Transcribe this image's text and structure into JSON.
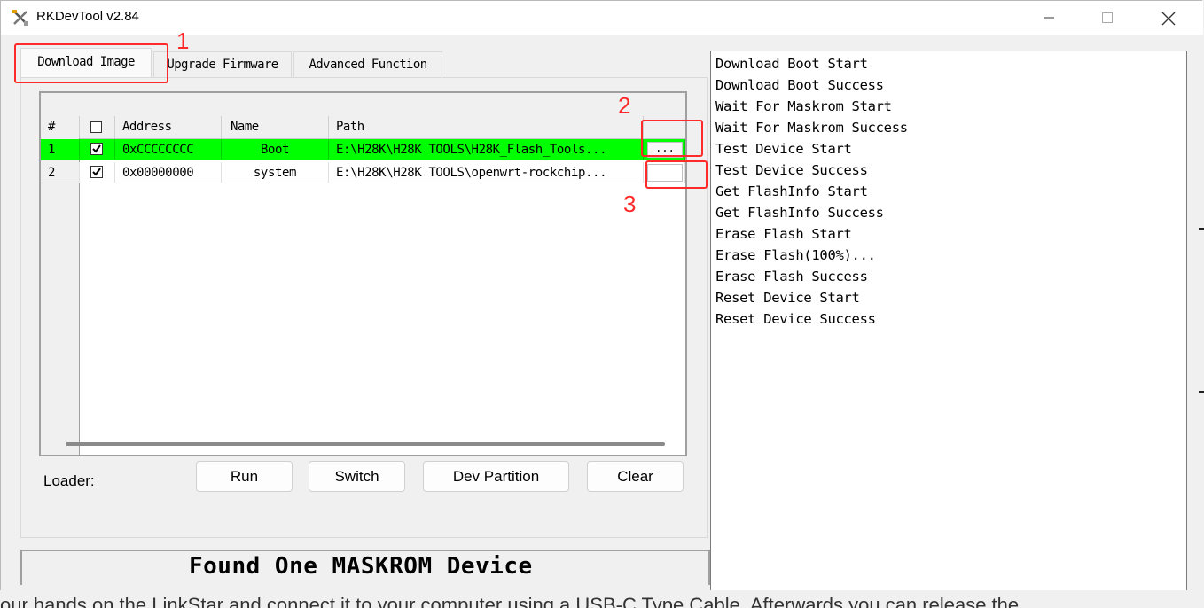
{
  "window": {
    "title": "RKDevTool v2.84"
  },
  "tabs": [
    {
      "label": "Download Image",
      "active": true
    },
    {
      "label": "Upgrade Firmware",
      "active": false
    },
    {
      "label": "Advanced Function",
      "active": false
    }
  ],
  "grid": {
    "headers": {
      "num": "#",
      "address": "Address",
      "name": "Name",
      "path": "Path"
    },
    "rows": [
      {
        "num": "1",
        "checked": true,
        "address": "0xCCCCCCCC",
        "name": "Boot",
        "path": "E:\\H28K\\H28K TOOLS\\H28K_Flash_Tools...",
        "button": "...",
        "highlight_color": "#00ff00"
      },
      {
        "num": "2",
        "checked": true,
        "address": "0x00000000",
        "name": "system",
        "path": "E:\\H28K\\H28K TOOLS\\openwrt-rockchip...",
        "button": ""
      }
    ]
  },
  "loader_label": "Loader:",
  "buttons": {
    "run": "Run",
    "switch": "Switch",
    "dev_partition": "Dev Partition",
    "clear": "Clear"
  },
  "status": "Found One MASKROM Device",
  "log": [
    "Download Boot Start",
    "Download Boot Success",
    "Wait For Maskrom Start",
    "Wait For Maskrom Success",
    "Test Device Start",
    "Test Device Success",
    "Get FlashInfo Start",
    "Get FlashInfo Success",
    "Erase Flash Start",
    "Erase Flash(100%)...",
    "Erase Flash Success",
    "Reset Device Start",
    "Reset Device Success"
  ],
  "annotations": {
    "one": "1",
    "two": "2",
    "three": "3",
    "color": "#ff2a2a"
  },
  "background_text": "our hands on the LinkStar and connect it to your computer using a USB-C Type Cable. Afterwards you can release the"
}
